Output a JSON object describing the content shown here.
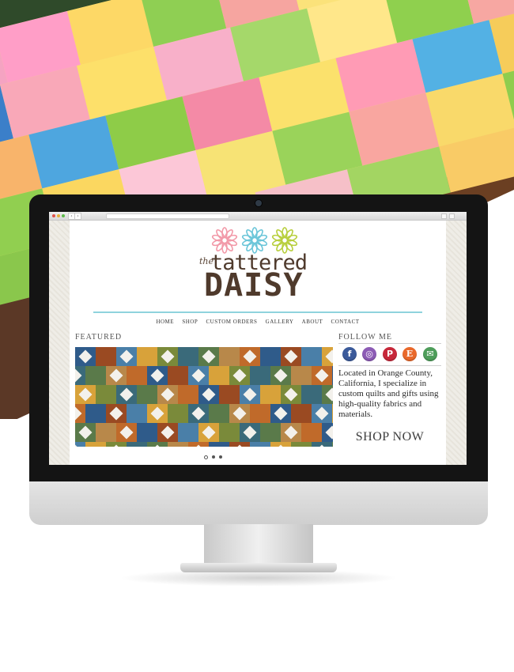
{
  "site": {
    "logo": {
      "prefix": "the",
      "line1": "tattered",
      "line2": "DAISY"
    },
    "nav": [
      "HOME",
      "SHOP",
      "CUSTOM ORDERS",
      "GALLERY",
      "ABOUT",
      "CONTACT"
    ],
    "featured": {
      "title": "FEATURED",
      "slides": 3,
      "active_slide": 1
    },
    "sidebar": {
      "follow_title": "FOLLOW ME",
      "social": [
        {
          "name": "facebook-icon",
          "glyph": "f",
          "color": "#3b5a9a"
        },
        {
          "name": "instagram-icon",
          "glyph": "◎",
          "color": "#8c5bb5"
        },
        {
          "name": "pinterest-icon",
          "glyph": "P",
          "color": "#c7283a"
        },
        {
          "name": "etsy-icon",
          "glyph": "E",
          "color": "#e9692b"
        },
        {
          "name": "email-icon",
          "glyph": "✉",
          "color": "#4e9d5a"
        }
      ],
      "about": "Located in Orange County, California, I specialize in custom quilts and gifts using high-quality fabrics and materials.",
      "cta": "SHOP NOW"
    },
    "accent_color": "#8fd3dd",
    "logo_flower_colors": [
      "#f29aa9",
      "#6cc6d9",
      "#b8cf3e"
    ]
  },
  "browser": {
    "icons": [
      "back-arrow-icon",
      "forward-arrow-icon",
      "share-icon",
      "tabs-icon"
    ]
  }
}
